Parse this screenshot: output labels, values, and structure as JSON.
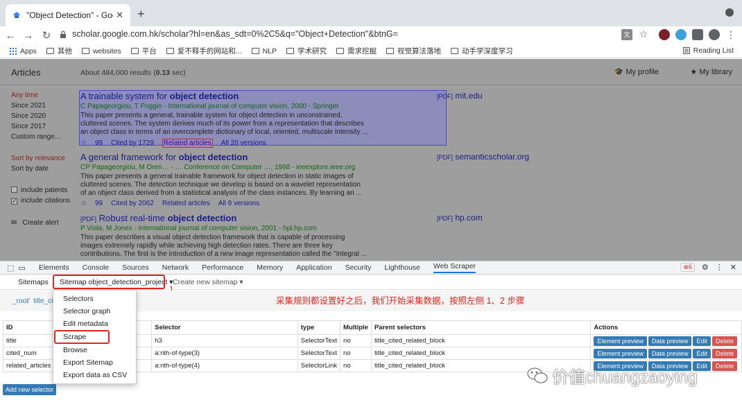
{
  "browser": {
    "tab_title": "\"Object Detection\" - Google S",
    "tab_close": "✕",
    "new_tab": "+",
    "url": "scholar.google.com.hk/scholar?hl=en&as_sdt=0%2C5&q=\"Object+Detection\"&btnG=",
    "back": "←",
    "forward": "→",
    "reload": "↻",
    "star": "☆",
    "menu": "⋮"
  },
  "bookmarks": {
    "apps": "Apps",
    "items": [
      "其他",
      "websites",
      "平台",
      "爱不释手的网站和...",
      "NLP",
      "学术研究",
      "需求挖掘",
      "视觉算法落地",
      "动手学深度学习"
    ],
    "reading_list": "Reading List"
  },
  "scholar": {
    "articles": "Articles",
    "about_prefix": "About 484,000 results (",
    "about_time": "0.13",
    "about_suffix": " sec)",
    "my_profile": "My profile",
    "my_library": "My library",
    "sidebar": {
      "any_time": "Any time",
      "since_2021": "Since 2021",
      "since_2020": "Since 2020",
      "since_2017": "Since 2017",
      "custom_range": "Custom range...",
      "sort_relevance": "Sort by relevance",
      "sort_date": "Sort by date",
      "include_patents": "include patents",
      "include_citations": "include citations",
      "create_alert": "Create alert"
    },
    "results": [
      {
        "title_pre": "A trainable system for ",
        "title_bold": "object detection",
        "title_tag": "",
        "authors": "C Papageorgiou, T Poggio - International journal of computer vision, 2000 - Springer",
        "snippet": [
          "This paper presents a general, trainable system for object detection in unconstrained,",
          "cluttered scenes. The system derives much of its power from a representation that describes",
          "an object class in terms of an overcomplete dictionary of local, oriented, multiscale intensity ..."
        ],
        "cited": "Cited by 1729",
        "related": "Related articles",
        "versions": "All 20 versions",
        "pdf_tag": "[PDF]",
        "pdf_site": "mit.edu"
      },
      {
        "title_pre": "A general framework for ",
        "title_bold": "object detection",
        "title_tag": "",
        "authors": "CP Papageorgiou, M Oren… - … Conference on Computer …, 1998 - ieeexplore.ieee.org",
        "snippet": [
          "This paper presents a general trainable framework for object detection in static images of",
          "cluttered scenes. The detection technique we develop is based on a wavelet representation",
          "of an object class derived from a statistical analysis of the class instances. By learning an ..."
        ],
        "cited": "Cited by 2062",
        "related": "Related articles",
        "versions": "All 9 versions",
        "pdf_tag": "[PDF]",
        "pdf_site": "semanticscholar.org"
      },
      {
        "title_pre": "Robust real-time ",
        "title_bold": "object detection",
        "title_tag": "[PDF]",
        "authors": "P Viola, M Jones - International journal of computer vision, 2001 - hpl.hp.com",
        "snippet": [
          "This paper describes a visual object detection framework that is capable of processing",
          "images extremely rapidly while achieving high detection rates. There are three key",
          "contributions. The first is the introduction of a new image representation called the \"Integral ..."
        ],
        "cited": "",
        "related": "",
        "versions": "",
        "pdf_tag": "[PDF]",
        "pdf_site": "hp.com"
      }
    ]
  },
  "devtools": {
    "tabs": [
      "Elements",
      "Console",
      "Sources",
      "Network",
      "Performance",
      "Memory",
      "Application",
      "Security",
      "Lighthouse",
      "Web Scraper"
    ],
    "active_tab": "Web Scraper",
    "error_count": "6"
  },
  "scraper": {
    "sitemaps": "Sitemaps",
    "sitemap_menu": "Sitemap object_detection_project ▾",
    "create_sitemap": "Create new sitemap ▾",
    "crumb_root": "_root",
    "crumb_sep": "/",
    "crumb_child": "title_cit",
    "annotation_1": "1",
    "annotation_2": "2",
    "annotation_text": "采集规则都设置好之后，我们开始采集数据，按照左侧 1、2 步骤",
    "menu_items": [
      "Selectors",
      "Selector graph",
      "Edit metadata",
      "Scrape",
      "Browse",
      "Export Sitemap",
      "Export data as CSV"
    ],
    "columns": [
      "ID",
      "Selector",
      "type",
      "Multiple",
      "Parent selectors",
      "Actions"
    ],
    "rows": [
      {
        "id": "title",
        "selector": "h3",
        "type": "SelectorText",
        "multiple": "no",
        "parent": "title_cited_related_block"
      },
      {
        "id": "cited_num",
        "selector": "a:nth-of-type(3)",
        "type": "SelectorText",
        "multiple": "no",
        "parent": "title_cited_related_block"
      },
      {
        "id": "related_articles",
        "selector": "a:nth-of-type(4)",
        "type": "SelectorLink",
        "multiple": "no",
        "parent": "title_cited_related_block"
      }
    ],
    "actions": {
      "preview": "Element preview",
      "data": "Data preview",
      "edit": "Edit",
      "delete": "Delete"
    },
    "add_selector": "Add new selector"
  },
  "watermark": "价值chuangzaoying",
  "colors": {
    "accent_red": "#e2251d",
    "btn_blue": "#337ab7",
    "btn_red": "#d9534f",
    "link": "#1a1a8c"
  }
}
